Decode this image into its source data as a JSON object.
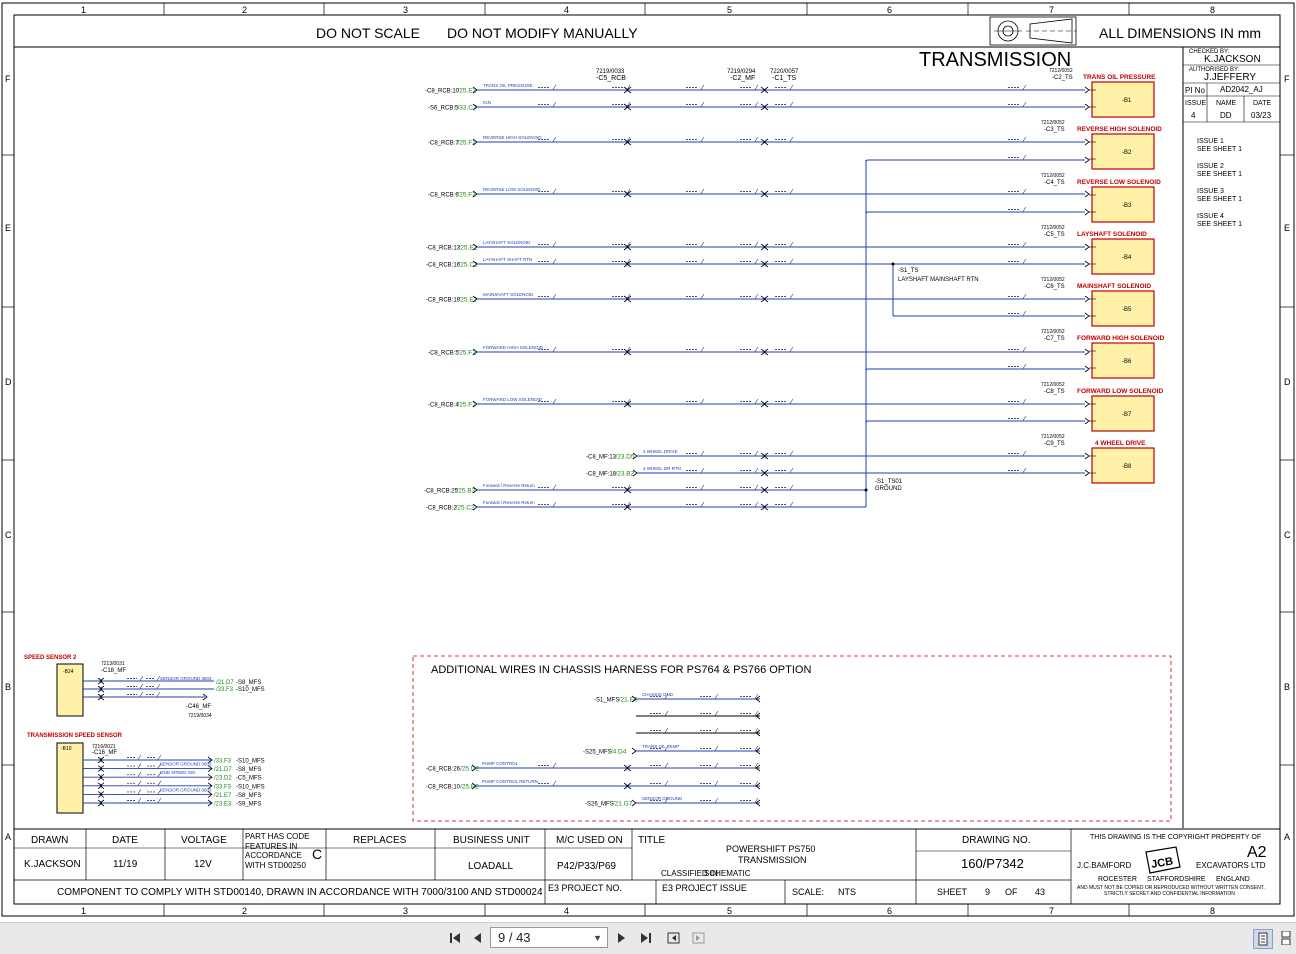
{
  "header": {
    "do_not_scale": "DO NOT SCALE",
    "do_not_modify": "DO NOT MODIFY MANUALLY",
    "dimensions": "ALL DIMENSIONS IN mm",
    "title": "TRANSMISSION"
  },
  "grid": {
    "columns": [
      "1",
      "2",
      "3",
      "4",
      "5",
      "6",
      "7",
      "8"
    ],
    "rows": [
      "F",
      "E",
      "D",
      "C",
      "B",
      "A"
    ]
  },
  "approvals": {
    "checked_label": "CHECKED BY:",
    "checked_by": "K.JACKSON",
    "authorised_label": "AUTHORISED BY:",
    "authorised_by": "J.JEFFERY",
    "pi_label": "PI No",
    "pi_no": "AD2042_AJ",
    "issue_h": "ISSUE",
    "name_h": "NAME",
    "date_h": "DATE",
    "issue": "4",
    "name": "DD",
    "date": "03/23"
  },
  "issues": [
    {
      "issue": "ISSUE 1",
      "note": "SEE SHEET 1"
    },
    {
      "issue": "ISSUE 2",
      "note": "SEE SHEET 1"
    },
    {
      "issue": "ISSUE 3",
      "note": "SEE SHEET 1"
    },
    {
      "issue": "ISSUE 4",
      "note": "SEE SHEET 1"
    }
  ],
  "connectors": {
    "c5_rcb_num": "7219/0033",
    "c5_rcb": "-C5_RCB",
    "c2_mf_num": "7219/0294",
    "c2_mf": "-C2_MF",
    "c1_ts_num": "7220/0057",
    "c1_ts": "-C1_TS"
  },
  "components": [
    {
      "label": "TRANS OIL PRESSURE",
      "num": "7212/0052",
      "conn": "-C2_TS",
      "ref": "-B1"
    },
    {
      "label": "REVERSE HIGH SOLENOID",
      "num": "7212/0052",
      "conn": "-C3_TS",
      "ref": "-B2"
    },
    {
      "label": "REVERSE LOW SOLENOID",
      "num": "7212/0052",
      "conn": "-C4_TS",
      "ref": "-B3"
    },
    {
      "label": "LAYSHAFT SOLENOID",
      "num": "7212/0052",
      "conn": "-C5_TS",
      "ref": "-B4"
    },
    {
      "label": "MAINSHAFT SOLENOID",
      "num": "7212/0052",
      "conn": "-C6_TS",
      "ref": "-B5"
    },
    {
      "label": "FORWARD HIGH SOLENOID",
      "num": "7212/0052",
      "conn": "-C7_TS",
      "ref": "-B6"
    },
    {
      "label": "FORWARD LOW SOLENOID",
      "num": "7212/0052",
      "conn": "-C8_TS",
      "ref": "-B7"
    },
    {
      "label": "4 WHEEL DRIVE",
      "num": "7212/0052",
      "conn": "-C9_TS",
      "ref": "-B8"
    }
  ],
  "wires": [
    {
      "src": "-C8_RCB:10",
      "ref": "/25.E2",
      "sig": "TRANS OIL PRESSURE"
    },
    {
      "src": "-S6_RCB:5",
      "ref": "/33.C7",
      "sig": "IGN"
    },
    {
      "src": "-C8_RCB:7",
      "ref": "/25.F2",
      "sig": "REVERSE HIGH SOLENOID"
    },
    {
      "src": "-C8_RCB:6",
      "ref": "/25.F2",
      "sig": "REVERSE LOW SOLENOID"
    },
    {
      "src": "-C8_RCB:13",
      "ref": "/25.E2",
      "sig": "LAYSHAFT SOLENOID"
    },
    {
      "src": "-C8_RCB:16",
      "ref": "/25.C2",
      "sig": "LAYSHAFT SHAFT RTN"
    },
    {
      "src": "-C8_RCB:19",
      "ref": "/25.E2",
      "sig": "MAINSHAFT SOLENOID"
    },
    {
      "src": "-C8_RCB:5",
      "ref": "/25.F2",
      "sig": "FORWARD HIGH SOLENOID"
    },
    {
      "src": "-C8_RCB:4",
      "ref": "/25.F2",
      "sig": "FORWARD LOW SOLENOID"
    },
    {
      "src": "-C8_MF:13",
      "ref": "/23.D5",
      "sig": "4 WHEEL DRIVE"
    },
    {
      "src": "-C8_MF:18",
      "ref": "/23.B2",
      "sig": "4 WHEEL DR RTN"
    },
    {
      "src": "-C8_RCB:25",
      "ref": "/25.B2",
      "sig": "Forward / Reverse Return"
    },
    {
      "src": "-C8_RCB:2",
      "ref": "/25.C2",
      "sig": "Forward / Reverse Return"
    }
  ],
  "junctions": {
    "s1_ts": "-S1_TS",
    "s1_ts_label": "LAYSHAFT MAINSHAFT RTN",
    "s1_ts01": "-S1_TS01",
    "ground": "GROUND"
  },
  "speed_sensor_2": {
    "title": "SPEED SENSOR 2",
    "num": "7213/0031",
    "conn": "-C18_MF",
    "ref": "-B24",
    "conn2": "-C46_MF",
    "num2": "7219/0034",
    "links": [
      {
        "sig": "SENSOR GROUND 3603",
        "ref": "/21.D7",
        "dest": "-S8_MFS"
      },
      {
        "sig": "",
        "ref": "/33.F3",
        "dest": "-S10_MFS"
      }
    ]
  },
  "trans_speed_sensor": {
    "title": "TRANSMISSION SPEED SENSOR",
    "num": "7216/0021",
    "conn": "-C16_MF",
    "ref": "-B10",
    "links": [
      {
        "sig": "",
        "ref": "/33.F3",
        "dest": "-S10_MFS"
      },
      {
        "sig": "SENSOR GROUND 3603",
        "ref": "/21.D7",
        "dest": "-S8_MFS"
      },
      {
        "sig": "GND SPEED SIG",
        "ref": "/23.D2",
        "dest": "-C5_MFS"
      },
      {
        "sig": "",
        "ref": "/33.F3",
        "dest": "-S10_MFS"
      },
      {
        "sig": "SENSOR GROUND 3603",
        "ref": "/21.E7",
        "dest": "-S8_MFS"
      },
      {
        "sig": "",
        "ref": "/23.E3",
        "dest": "-S9_MFS"
      }
    ]
  },
  "additional": {
    "title": "ADDITIONAL WIRES IN CHASSIS HARNESS FOR PS764 & PS766 OPTION",
    "wires": [
      {
        "src": "-S1_MFS",
        "ref": "/21.E6",
        "sig": "CHASSIS GND"
      },
      {
        "src": "",
        "ref": "",
        "sig": ""
      },
      {
        "src": "",
        "ref": "",
        "sig": ""
      },
      {
        "src": "-S25_MFS",
        "ref": "/4.D4",
        "sig": "TRANS OIL TEMP"
      },
      {
        "src": "-C8_RCB:26",
        "ref": "/25.D2",
        "sig": "PUMP CONTROL"
      },
      {
        "src": "-C8_RCB:10",
        "ref": "/25.B2",
        "sig": "PUMP CONTROL RETURN"
      },
      {
        "src": "-S26_MFS",
        "ref": "/21.G7",
        "sig": "SENSOR GROUND"
      }
    ]
  },
  "title_block": {
    "drawn_h": "DRAWN",
    "date_h": "DATE",
    "voltage_h": "VOLTAGE",
    "part_code_text": "PART HAS CODE FEATURES IN ACCORDANCE WITH STD00250",
    "part_code_letter": "C",
    "replaces_h": "REPLACES",
    "business_h": "BUSINESS UNIT",
    "mc_h": "M/C USED ON",
    "title_h": "TITLE",
    "drawn": "K.JACKSON",
    "date": "11/19",
    "voltage": "12V",
    "business": "LOADALL",
    "mc": "P42/P33/P69",
    "title1": "POWERSHIFT PS750",
    "title2": "TRANSMISSION",
    "classified_h": "CLASSIFIED IN",
    "classified": "SCHEMATIC",
    "drawing_no_h": "DRAWING NO.",
    "drawing_no": "160/P7342",
    "copyright": "THIS DRAWING IS THE COPYRIGHT PROPERTY OF",
    "size": "A2",
    "company1": "J.C.BAMFORD",
    "company2": "EXCAVATORS LTD",
    "addr1": "ROCESTER",
    "addr2": "STAFFORDSHIRE",
    "addr3": "ENGLAND",
    "warn1": "AND MUST NOT BE COPIED OR REPRODUCED WITHOUT WRITTEN CONSENT.",
    "warn2": "STRICTLY SECRET AND CONFIDENTIAL INFORMATION",
    "comply": "COMPONENT TO COMPLY WITH STD00140, DRAWN IN ACCORDANCE WITH 7000/3100 AND STD00024",
    "e3_h": "E3 PROJECT NO.",
    "e3_issue": "E3 PROJECT ISSUE",
    "scale_h": "SCALE:",
    "scale": "NTS",
    "sheet_h": "SHEET",
    "sheet": "9",
    "of_h": "OF",
    "of": "43"
  },
  "viewer": {
    "page_value": "9 / 43",
    "accent": "#1f3fb5"
  }
}
